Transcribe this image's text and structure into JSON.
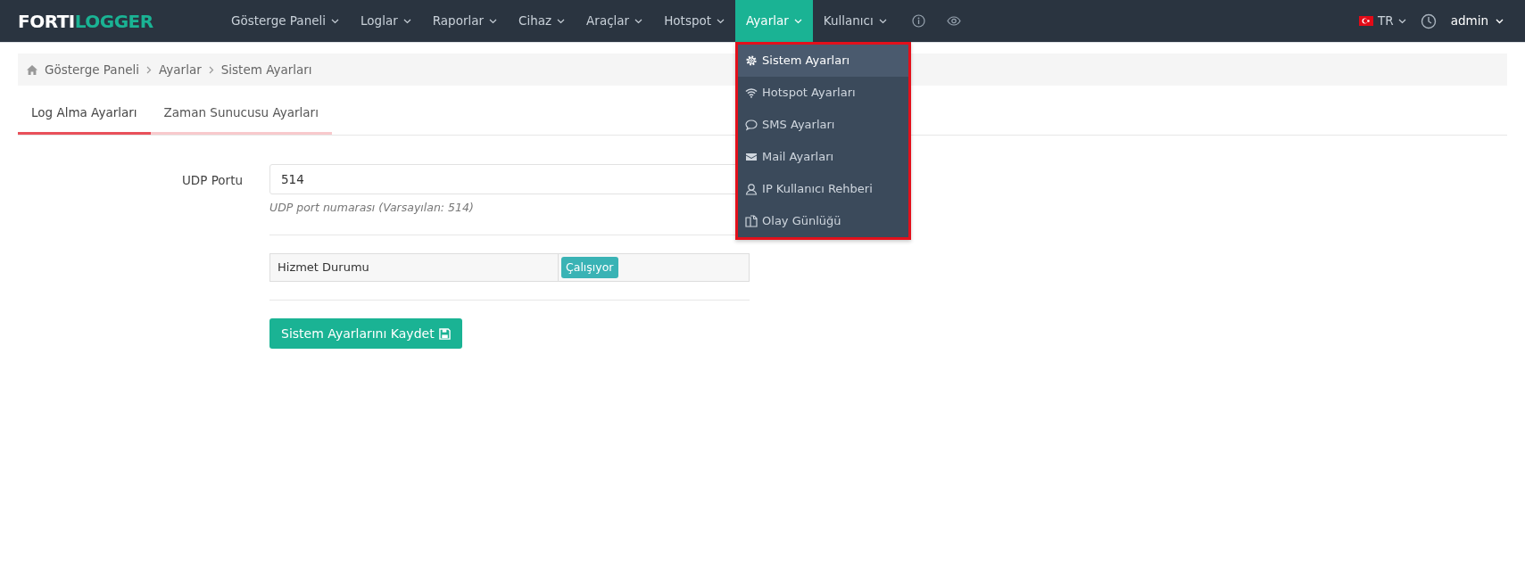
{
  "brand": {
    "part1": "FORTI",
    "part2": "LOGGER"
  },
  "nav": [
    {
      "label": "Gösterge Paneli",
      "selected": false
    },
    {
      "label": "Loglar",
      "selected": false
    },
    {
      "label": "Raporlar",
      "selected": false
    },
    {
      "label": "Cihaz",
      "selected": false
    },
    {
      "label": "Araçlar",
      "selected": false
    },
    {
      "label": "Hotspot",
      "selected": false
    },
    {
      "label": "Ayarlar",
      "selected": true
    },
    {
      "label": "Kullanıcı",
      "selected": false
    }
  ],
  "language": "TR",
  "user": "admin",
  "dropdown": [
    {
      "label": "Sistem Ayarları",
      "selected": true
    },
    {
      "label": "Hotspot Ayarları",
      "selected": false
    },
    {
      "label": "SMS Ayarları",
      "selected": false
    },
    {
      "label": "Mail Ayarları",
      "selected": false
    },
    {
      "label": "IP Kullanıcı Rehberi",
      "selected": false
    },
    {
      "label": "Olay Günlüğü",
      "selected": false
    }
  ],
  "breadcrumb": [
    "Gösterge Paneli",
    "Ayarlar",
    "Sistem Ayarları"
  ],
  "tabs": [
    {
      "label": "Log Alma Ayarları",
      "selected": true
    },
    {
      "label": "Zaman Sunucusu Ayarları",
      "selected": false
    }
  ],
  "form": {
    "label": "UDP Portu",
    "value": "514",
    "help": "UDP port numarası (Varsayılan: 514)"
  },
  "status": {
    "label": "Hizmet Durumu",
    "value": "Çalışıyor"
  },
  "save_button": "Sistem Ayarlarını Kaydet"
}
